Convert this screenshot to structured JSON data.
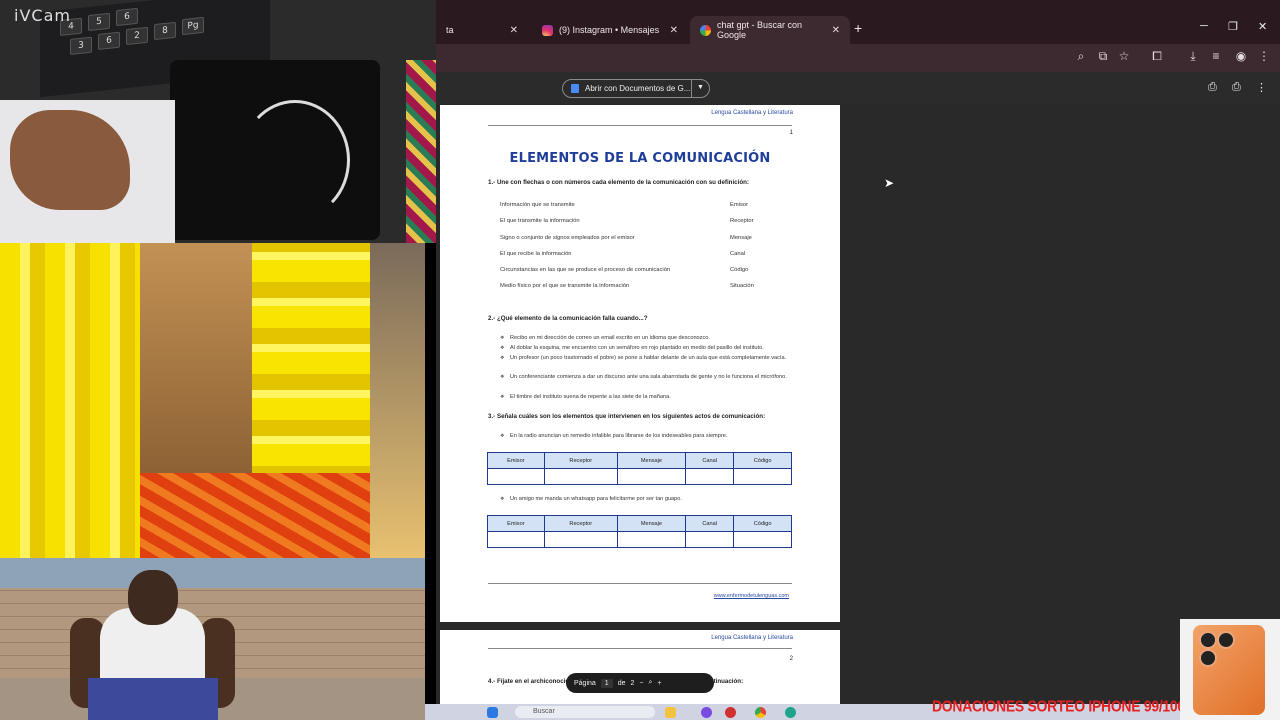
{
  "overlay": {
    "webcam_label": "iVCam",
    "keyboard_keys": [
      "4",
      "5",
      "6",
      "3",
      "6",
      "2",
      "8",
      "Pg"
    ]
  },
  "browser": {
    "tabs": [
      {
        "label": "(9) Instagram • Mensajes",
        "icon": "instagram-icon"
      },
      {
        "label": "chat gpt - Buscar con Google",
        "icon": "google-icon"
      }
    ],
    "first_tab_fragment": "ta"
  },
  "viewer": {
    "open_with_label": "Abrir con Documentos de G...",
    "pager": {
      "label": "Página",
      "current": "1",
      "of": "de",
      "total": "2"
    }
  },
  "document": {
    "header": "Lengua Castellana y Literatura",
    "page1_number": "1",
    "page2_number": "2",
    "title": "ELEMENTOS DE LA COMUNICACIÓN",
    "q1": "1.- Une con flechas o con números cada elemento de la comunicación con su definición:",
    "q1_left": [
      "Información que se transmite",
      "El que transmite la información",
      "Signo o conjunto de signos empleados por el emisor",
      "El que recibe la información",
      "Circunstancias en las que se produce el proceso de comunicación",
      "Medio físico por el que se transmite la información"
    ],
    "q1_right": [
      "Emisor",
      "Receptor",
      "Mensaje",
      "Canal",
      "Código",
      "Situación"
    ],
    "q2": "2.- ¿Qué elemento de la comunicación falla cuando...?",
    "q2_items": [
      "Recibo en mi dirección de correo un email escrito en un idioma que desconozco.",
      "Al doblar la esquina, me encuentro con un semáforo en rojo plantado en medio del pasillo del instituto.",
      "Un profesor (un poco trastornado el pobre) se pone a hablar delante de un aula que está completamente vacía.",
      "Un conferenciante comienza a dar un discurso ante una sala abarrotada de gente y no le funciona el micrófono.",
      "El timbre del instituto suena de repente a las siete de la mañana."
    ],
    "q3": "3.- Señala cuáles son los elementos que intervienen en los siguientes actos de comunicación:",
    "q3_item1": "En la radio anuncian un remedio infalible para librarse de los indeseables para siempre.",
    "q3_item2": "Un amigo me manda un whatsapp para felicitarme por ser tan guapo.",
    "table_headers": [
      "Emisor",
      "Receptor",
      "Mensaje",
      "Canal",
      "Código"
    ],
    "footer_link": "www.enfermodetulenguas.com",
    "q4": "4.- Fíjate en el archiconocido ... contesta a las preguntas que aparecen a continuación:"
  },
  "taskbar": {
    "search_placeholder": "Buscar"
  },
  "promo": {
    "text": "DONACIONES SORTEO IPHONE 99/100"
  }
}
